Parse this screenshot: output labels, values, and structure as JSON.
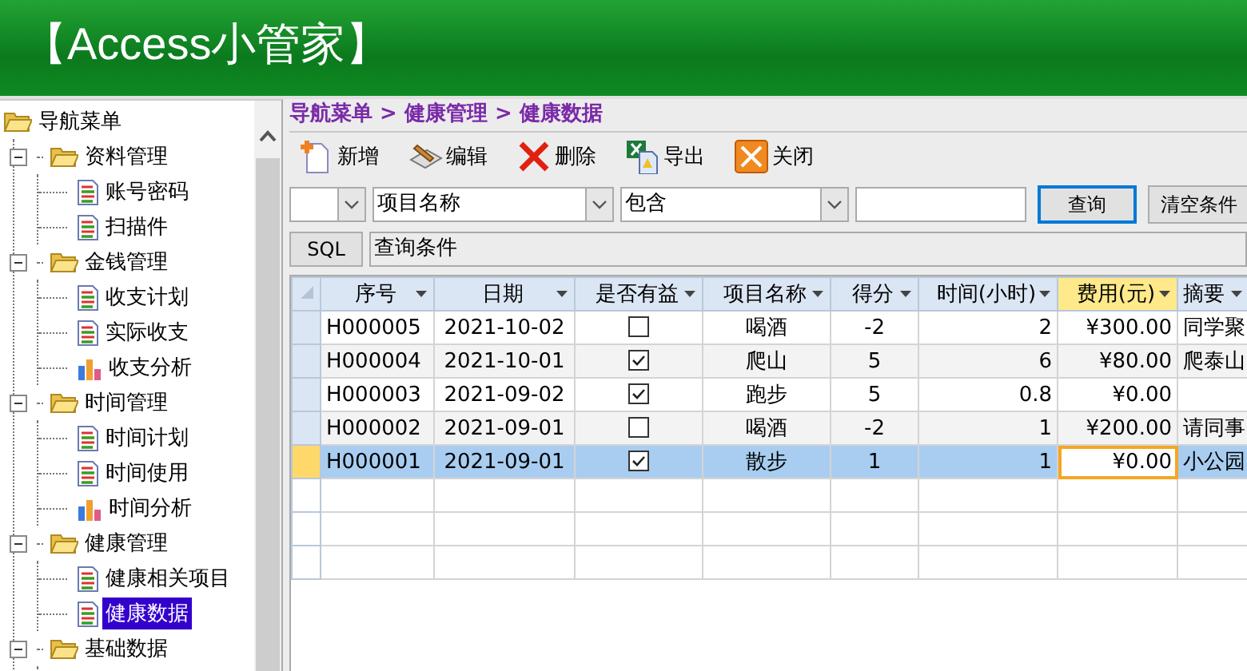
{
  "app_title": "【Access小管家】",
  "nav": {
    "root": {
      "label": "导航菜单",
      "kind": "folder",
      "children": [
        {
          "label": "资料管理",
          "kind": "folder",
          "expanded": true,
          "selected": false,
          "children": [
            {
              "label": "账号密码",
              "kind": "doc",
              "selected": false
            },
            {
              "label": "扫描件",
              "kind": "doc",
              "selected": false
            }
          ]
        },
        {
          "label": "金钱管理",
          "kind": "folder",
          "expanded": true,
          "selected": false,
          "children": [
            {
              "label": "收支计划",
              "kind": "doc",
              "selected": false
            },
            {
              "label": "实际收支",
              "kind": "doc",
              "selected": false
            },
            {
              "label": "收支分析",
              "kind": "chart",
              "selected": false
            }
          ]
        },
        {
          "label": "时间管理",
          "kind": "folder",
          "expanded": true,
          "selected": false,
          "children": [
            {
              "label": "时间计划",
              "kind": "doc",
              "selected": false
            },
            {
              "label": "时间使用",
              "kind": "doc",
              "selected": false
            },
            {
              "label": "时间分析",
              "kind": "chart",
              "selected": false
            }
          ]
        },
        {
          "label": "健康管理",
          "kind": "folder",
          "expanded": true,
          "selected": false,
          "children": [
            {
              "label": "健康相关项目",
              "kind": "doc",
              "selected": false
            },
            {
              "label": "健康数据",
              "kind": "doc",
              "selected": true
            }
          ]
        },
        {
          "label": "基础数据",
          "kind": "folder",
          "expanded": true,
          "selected": false
        }
      ]
    }
  },
  "breadcrumb": "导航菜单 > 健康管理 > 健康数据",
  "toolbar": [
    {
      "kind": "new",
      "label": "新增"
    },
    {
      "kind": "edit",
      "label": "编辑"
    },
    {
      "kind": "delete",
      "label": "删除"
    },
    {
      "kind": "export",
      "label": "导出"
    },
    {
      "kind": "close",
      "label": "关闭"
    }
  ],
  "filter": {
    "selects": [
      {
        "value": "项目名称"
      },
      {
        "value": "包含"
      }
    ],
    "buttons": [
      {
        "label": "查询",
        "focused": true
      },
      {
        "label": "清空条件",
        "focused": false
      }
    ],
    "sql_button": "SQL",
    "condition_field": {
      "value": "查询条件"
    }
  },
  "table": {
    "columns": [
      {
        "label": "序号",
        "selected": false
      },
      {
        "label": "日期",
        "selected": false
      },
      {
        "label": "是否有益",
        "selected": false
      },
      {
        "label": "项目名称",
        "selected": false
      },
      {
        "label": "得分",
        "selected": false
      },
      {
        "label": "时间(小时)",
        "selected": false
      },
      {
        "label": "费用(元)",
        "selected": true
      },
      {
        "label": "摘要",
        "selected": false
      }
    ],
    "rows": [
      {
        "id": "H000005",
        "date": "2021-10-02",
        "beneficial": false,
        "item": "喝酒",
        "score": "-2",
        "hours": "2",
        "cost": "¥300.00",
        "note": "同学聚",
        "selected": false
      },
      {
        "id": "H000004",
        "date": "2021-10-01",
        "beneficial": true,
        "item": "爬山",
        "score": "5",
        "hours": "6",
        "cost": "¥80.00",
        "note": "爬泰山",
        "selected": false
      },
      {
        "id": "H000003",
        "date": "2021-09-02",
        "beneficial": true,
        "item": "跑步",
        "score": "5",
        "hours": "0.8",
        "cost": "¥0.00",
        "note": null,
        "selected": false
      },
      {
        "id": "H000002",
        "date": "2021-09-01",
        "beneficial": false,
        "item": "喝酒",
        "score": "-2",
        "hours": "1",
        "cost": "¥200.00",
        "note": "请同事",
        "selected": false
      },
      {
        "id": "H000001",
        "date": "2021-09-01",
        "beneficial": true,
        "item": "散步",
        "score": "1",
        "hours": "1",
        "cost": "¥0.00",
        "note": "小公园",
        "selected": true
      }
    ]
  }
}
